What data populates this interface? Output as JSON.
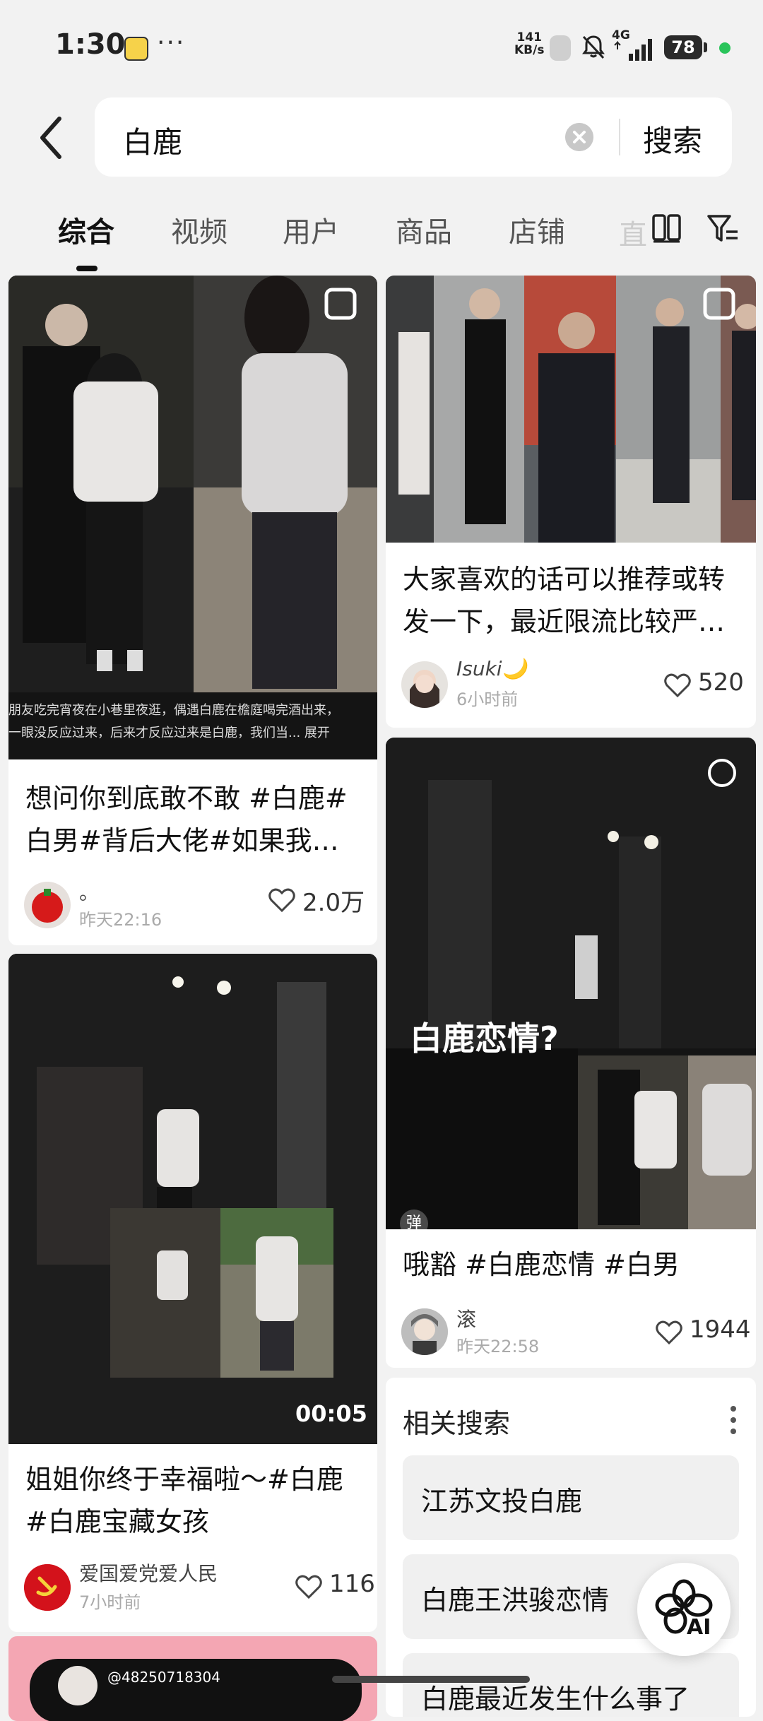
{
  "status_bar": {
    "time": "1:30",
    "dots": "···",
    "net_speed_value": "141",
    "net_speed_unit": "KB/s",
    "network_type": "4G",
    "battery": "78"
  },
  "search": {
    "query": "白鹿",
    "button_label": "搜索"
  },
  "tabs": [
    "综合",
    "视频",
    "用户",
    "商品",
    "店铺"
  ],
  "tab_overflow_char": "直",
  "posts": [
    {
      "title_line1": "想问你到底敢不敢 #白鹿#",
      "title_line2": "白男#背后大佬#如果我…",
      "caption_line1": "朋友吃完宵夜在小巷里夜逛，偶遇白鹿在檐庭喝完酒出来，",
      "caption_line2": "一眼没反应过来，后来才反应过来是白鹿，我们当... 展开",
      "author": "。",
      "time": "昨天22:16",
      "likes": "2.0万"
    },
    {
      "title_line1": "大家喜欢的话可以推荐或转",
      "title_line2": "发一下，最近限流比较严…",
      "author": "Isuki🌙",
      "time": "6小时前",
      "likes": "520"
    },
    {
      "overlay_text": "白鹿恋情?",
      "danmaku_badge": "弹",
      "title_line1": "哦豁 #白鹿恋情 #白男",
      "author": "滚",
      "time": "昨天22:58",
      "likes": "1944"
    },
    {
      "video_duration": "00:05",
      "title_line1": "姐姐你终于幸福啦～#白鹿",
      "title_line2": "#白鹿宝藏女孩",
      "author": "爱国爱党爱人民",
      "time": "7小时前",
      "likes": "116"
    }
  ],
  "next_post_username": "@48250718304",
  "related": {
    "title": "相关搜索",
    "items": [
      "江苏文投白鹿",
      "白鹿王洪骏恋情",
      "白鹿最近发生什么事了"
    ]
  },
  "ai_button_label": "AI",
  "colors": {
    "background": "#f2f2f2",
    "card": "#ffffff",
    "accent_dark": "#111111",
    "badge_red": "#d3121b"
  }
}
